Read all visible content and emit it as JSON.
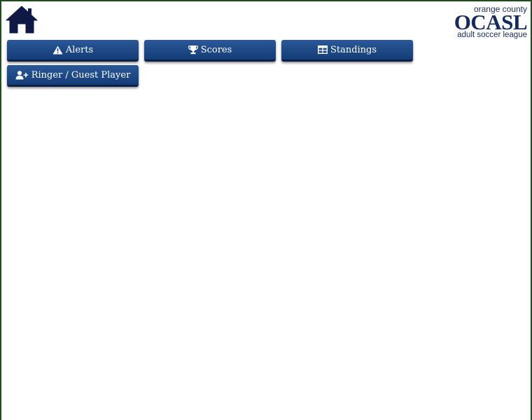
{
  "header": {
    "home_icon": "home-icon",
    "logo": {
      "line1": "orange county",
      "line2": "OCASL",
      "line3": "adult soccer league"
    }
  },
  "nav": {
    "buttons": [
      {
        "label": "Alerts",
        "icon": "warning-icon"
      },
      {
        "label": "Scores",
        "icon": "trophy-icon"
      },
      {
        "label": "Standings",
        "icon": "table-icon"
      },
      {
        "label": "Ringer / Guest Player",
        "icon": "user-plus-icon"
      }
    ]
  },
  "colors": {
    "button_bg": "#1e4a87",
    "button_text": "#ffffff",
    "frame_border": "#1e4d1e",
    "brand_navy": "#152a5e"
  }
}
